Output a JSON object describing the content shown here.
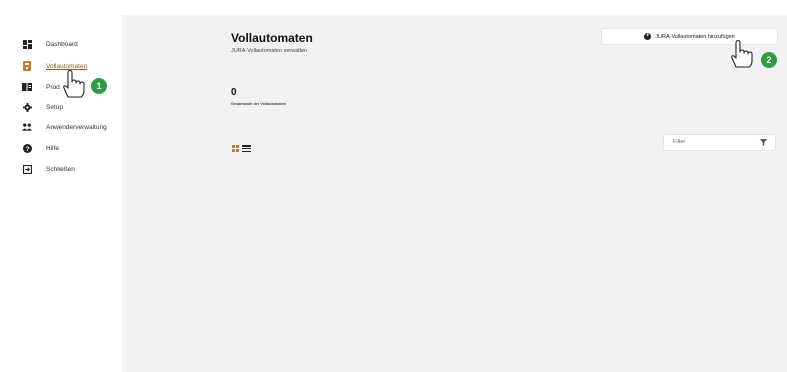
{
  "sidebar": {
    "items": [
      {
        "label": "Dashboard",
        "icon": "dashboard-icon"
      },
      {
        "label": "Vollautomaten",
        "icon": "coffee-machine-icon",
        "active": true
      },
      {
        "label": "Prod",
        "icon": "products-icon"
      },
      {
        "label": "Setup",
        "icon": "gear-icon"
      },
      {
        "label": "Anwenderverwaltung",
        "icon": "users-icon"
      },
      {
        "label": "Hilfe",
        "icon": "help-icon"
      },
      {
        "label": "Schließen",
        "icon": "logout-icon"
      }
    ]
  },
  "header": {
    "title": "Vollautomaten",
    "subtitle": "JURA-Vollautomaten verwalten",
    "add_button_label": "JURA-Vollautomaten hinzufügen"
  },
  "summary": {
    "count": "0",
    "count_label": "Gesamtzahl der Vollautomaten"
  },
  "toolbar": {
    "filter_label": "Filter"
  },
  "callouts": [
    "1",
    "2"
  ],
  "colors": {
    "accent": "#c47a30",
    "callout": "#2e9a42",
    "main_bg": "#f2f2f2"
  }
}
